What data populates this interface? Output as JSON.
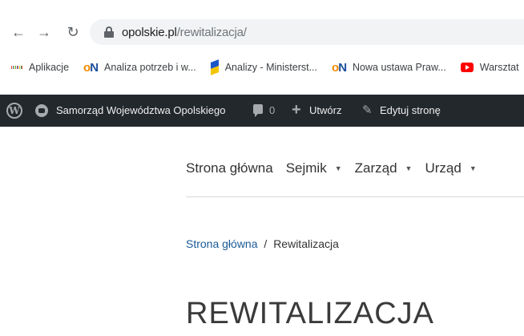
{
  "browser": {
    "url_host": "opolskie.pl",
    "url_path": "/rewitalizacja/"
  },
  "bookmarks": [
    {
      "icon": "apps-grid-icon",
      "label": "Aplikacje"
    },
    {
      "icon": "on-logo-icon",
      "label": "Analiza potrzeb i w..."
    },
    {
      "icon": "ministry-flag-icon",
      "label": "Analizy - Ministerst..."
    },
    {
      "icon": "on-logo-icon",
      "label": "Nowa ustawa Praw..."
    },
    {
      "icon": "youtube-icon",
      "label": "Warsztat"
    }
  ],
  "adminbar": {
    "site_name": "Samorząd Województwa Opolskiego",
    "comment_count": "0",
    "new_label": "Utwórz",
    "edit_label": "Edytuj stronę"
  },
  "site_nav": {
    "items": [
      {
        "label": "Strona główna",
        "has_dropdown": false
      },
      {
        "label": "Sejmik",
        "has_dropdown": true
      },
      {
        "label": "Zarząd",
        "has_dropdown": true
      },
      {
        "label": "Urząd",
        "has_dropdown": true
      }
    ],
    "caret_glyph": "▼"
  },
  "breadcrumb": {
    "home": "Strona główna",
    "separator": "/",
    "current": "Rewitalizacja"
  },
  "page": {
    "title": "REWITALIZACJA"
  },
  "colors": {
    "adminbar_bg": "#23282d",
    "link": "#1a5a96",
    "on_orange": "#f08a00",
    "on_blue": "#1a4e9c"
  }
}
